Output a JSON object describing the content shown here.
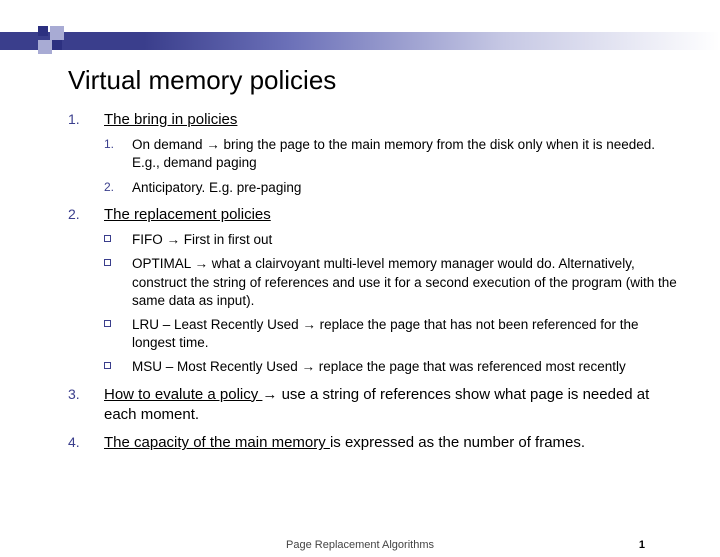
{
  "title": "Virtual memory policies",
  "items": [
    {
      "num": "1.",
      "head": "The bring in policies",
      "tail": "",
      "sub_style": "num",
      "subs": [
        {
          "marker": "1.",
          "text": "On demand → bring the page to the main memory from the disk only when it is needed. E.g., demand paging"
        },
        {
          "marker": "2.",
          "text": "Anticipatory. E.g. pre-paging"
        }
      ]
    },
    {
      "num": "2.",
      "head": "The replacement policies",
      "tail": "",
      "sub_style": "square",
      "subs": [
        {
          "marker": "",
          "text": "FIFO → First in first out"
        },
        {
          "marker": "",
          "text": "OPTIMAL → what a clairvoyant multi-level memory manager would do. Alternatively, construct the string of references and use it for a second execution of the program (with the same data as input)."
        },
        {
          "marker": "",
          "text": "LRU – Least Recently Used → replace the page that has not been referenced for the longest time."
        },
        {
          "marker": "",
          "text": "MSU – Most Recently Used → replace the page that was referenced most recently"
        }
      ]
    },
    {
      "num": "3.",
      "head": "How to evalute a policy ",
      "tail": "→ use a string of references show what page is needed at each moment.",
      "sub_style": "none",
      "subs": []
    },
    {
      "num": "4.",
      "head": "The capacity of the main memory ",
      "tail": " is expressed as  the number of frames.",
      "sub_style": "none",
      "subs": []
    }
  ],
  "footer": {
    "title": "Page Replacement Algorithms",
    "page": "1"
  }
}
